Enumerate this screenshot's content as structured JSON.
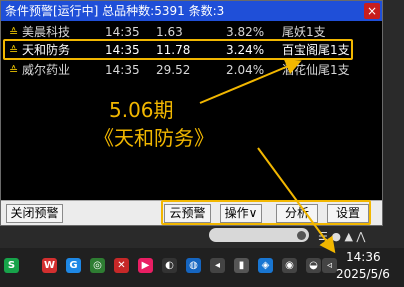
{
  "window": {
    "title": "条件预警[运行中] 总品种数:5391 条数:3",
    "close": "×"
  },
  "rows": [
    {
      "arrow": "≙",
      "name": "美晨科技",
      "time": "14:35",
      "price": "1.63",
      "pct": "3.82%",
      "signal": "尾妖1支"
    },
    {
      "arrow": "≙",
      "name": "天和防务",
      "time": "14:35",
      "price": "11.78",
      "pct": "3.24%",
      "signal": "百宝阁尾1支"
    },
    {
      "arrow": "≙",
      "name": "威尔药业",
      "time": "14:35",
      "price": "29.52",
      "pct": "2.04%",
      "signal": "酒花仙尾1支"
    }
  ],
  "annotation": {
    "date": "5.06期",
    "name": "《天和防务》"
  },
  "buttons": {
    "close_alert": "关闭预警",
    "cloud_alert": "云预警",
    "operate": "操作∨",
    "analyze": "分析",
    "settings": "设置"
  },
  "tray": {
    "symbols": "☰ ● ▲ ⋀"
  },
  "taskbar": {
    "icons": [
      "S",
      "W",
      "G",
      "◎",
      "✕",
      "▶",
      "◐",
      "◍",
      "◂",
      "▮",
      "◈",
      "◉",
      "◒",
      "◃"
    ],
    "time": "14:36",
    "date": "2025/5/6"
  },
  "colors": {
    "title_bg": "#1f4fd8",
    "highlight": "#f2b700",
    "list_bg": "#000000"
  }
}
